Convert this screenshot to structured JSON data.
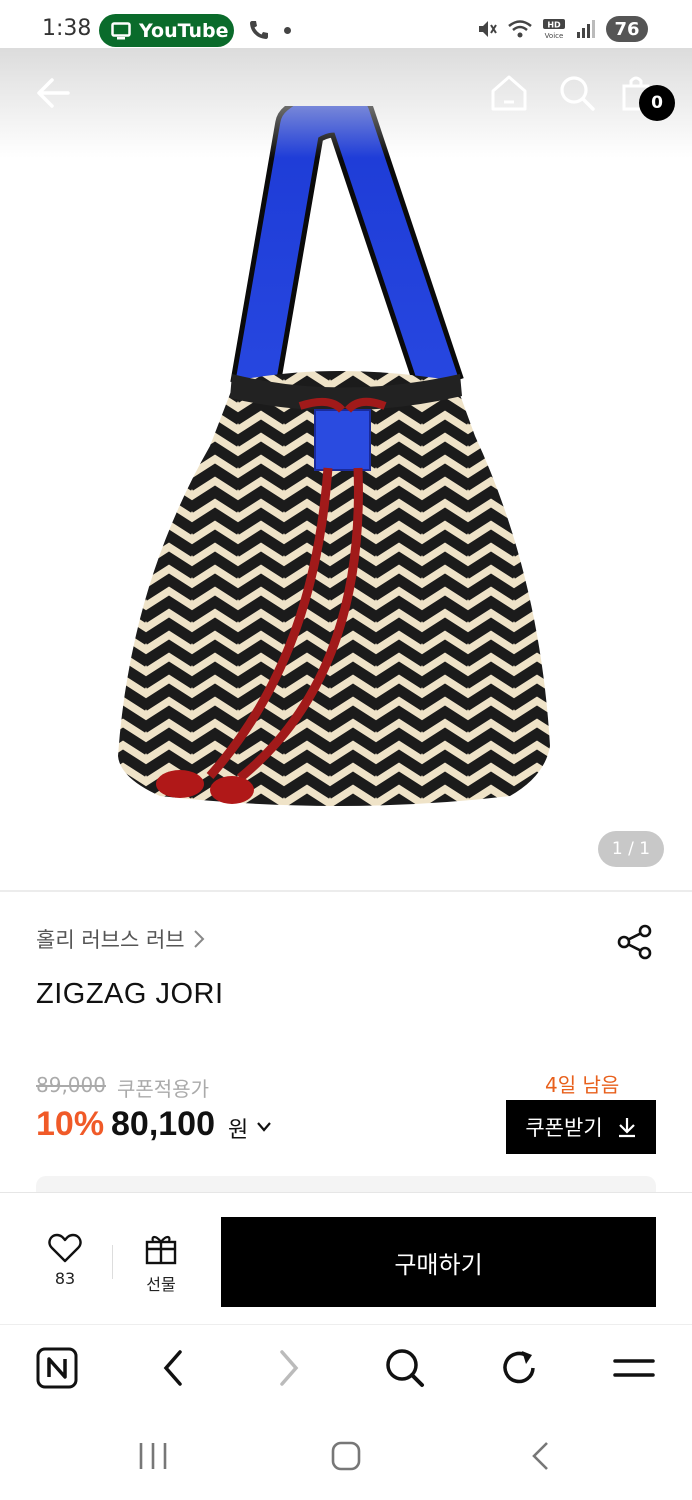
{
  "status_bar": {
    "time": "1:38",
    "app_pill": "YouTube",
    "battery": "76"
  },
  "header": {
    "cart_count": "0"
  },
  "gallery": {
    "counter": "1 / 1"
  },
  "product": {
    "brand": "홀리 러브스 러브",
    "title": "ZIGZAG JORI",
    "original_price": "89,000",
    "coupon_applied_label": "쿠폰적용가",
    "discount": "10%",
    "price": "80,100",
    "currency": "원",
    "days_left": "4일 남음",
    "coupon_button": "쿠폰받기"
  },
  "buy_bar": {
    "like_count": "83",
    "gift_label": "선물",
    "purchase_label": "구매하기"
  },
  "colors": {
    "accent": "#f05a28",
    "pill_green": "#0a6b2b",
    "button_black": "#000000"
  },
  "icons": [
    "back-arrow-icon",
    "home-icon",
    "search-icon",
    "cart-icon",
    "share-icon",
    "heart-icon",
    "gift-icon",
    "download-icon",
    "naver-icon",
    "refresh-icon",
    "menu-icon"
  ]
}
